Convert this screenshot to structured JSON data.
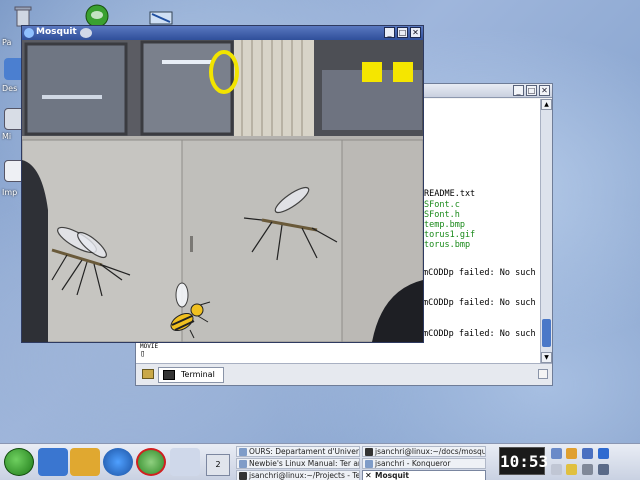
{
  "desktop": {
    "icon_labels": [
      "Pa",
      "Des",
      "Mi",
      "Imp"
    ]
  },
  "mosquit_window": {
    "title": "Mosquit",
    "buttons": [
      "_",
      "□",
      "✕"
    ]
  },
  "terminal_window": {
    "buttons": [
      "_",
      "□",
      "✕"
    ],
    "files": [
      {
        "name": "README.txt",
        "color": "#000000"
      },
      {
        "name": "SFont.c",
        "color": "#1a8a1a"
      },
      {
        "name": "SFont.h",
        "color": "#1a8a1a"
      },
      {
        "name": "temp.bmp",
        "color": "#1a8a1a"
      },
      {
        "name": "torus1.gif",
        "color": "#1a8a1a"
      },
      {
        "name": "torus.bmp",
        "color": "#1a8a1a"
      }
    ],
    "error_lines": [
      "mCODDp failed: No such",
      "mCODDp failed: No such",
      "mCODDp failed: No such"
    ],
    "partial_line": "MOVIE",
    "cursor": "▯",
    "tab_label": "Terminal"
  },
  "taskbar": {
    "pager_label": "2",
    "tasks": [
      {
        "label": "OURS: Departament d'Univer",
        "active": false
      },
      {
        "label": "jsanchri@linux:~/docs/mosquit",
        "active": false
      },
      {
        "label": "Newbie's Linux Manual: Ter am",
        "active": false
      },
      {
        "label": "jsanchri - Konqueror",
        "active": false
      },
      {
        "label": "jsanchri@linux:~/Projects - Te",
        "active": false
      },
      {
        "label": "Mosquit",
        "active": true
      }
    ],
    "clock": "10:53"
  },
  "colors": {
    "mosquit_title": "#2f4f9a",
    "target_ring": "#f2e400",
    "life_square": "#f5e600"
  }
}
